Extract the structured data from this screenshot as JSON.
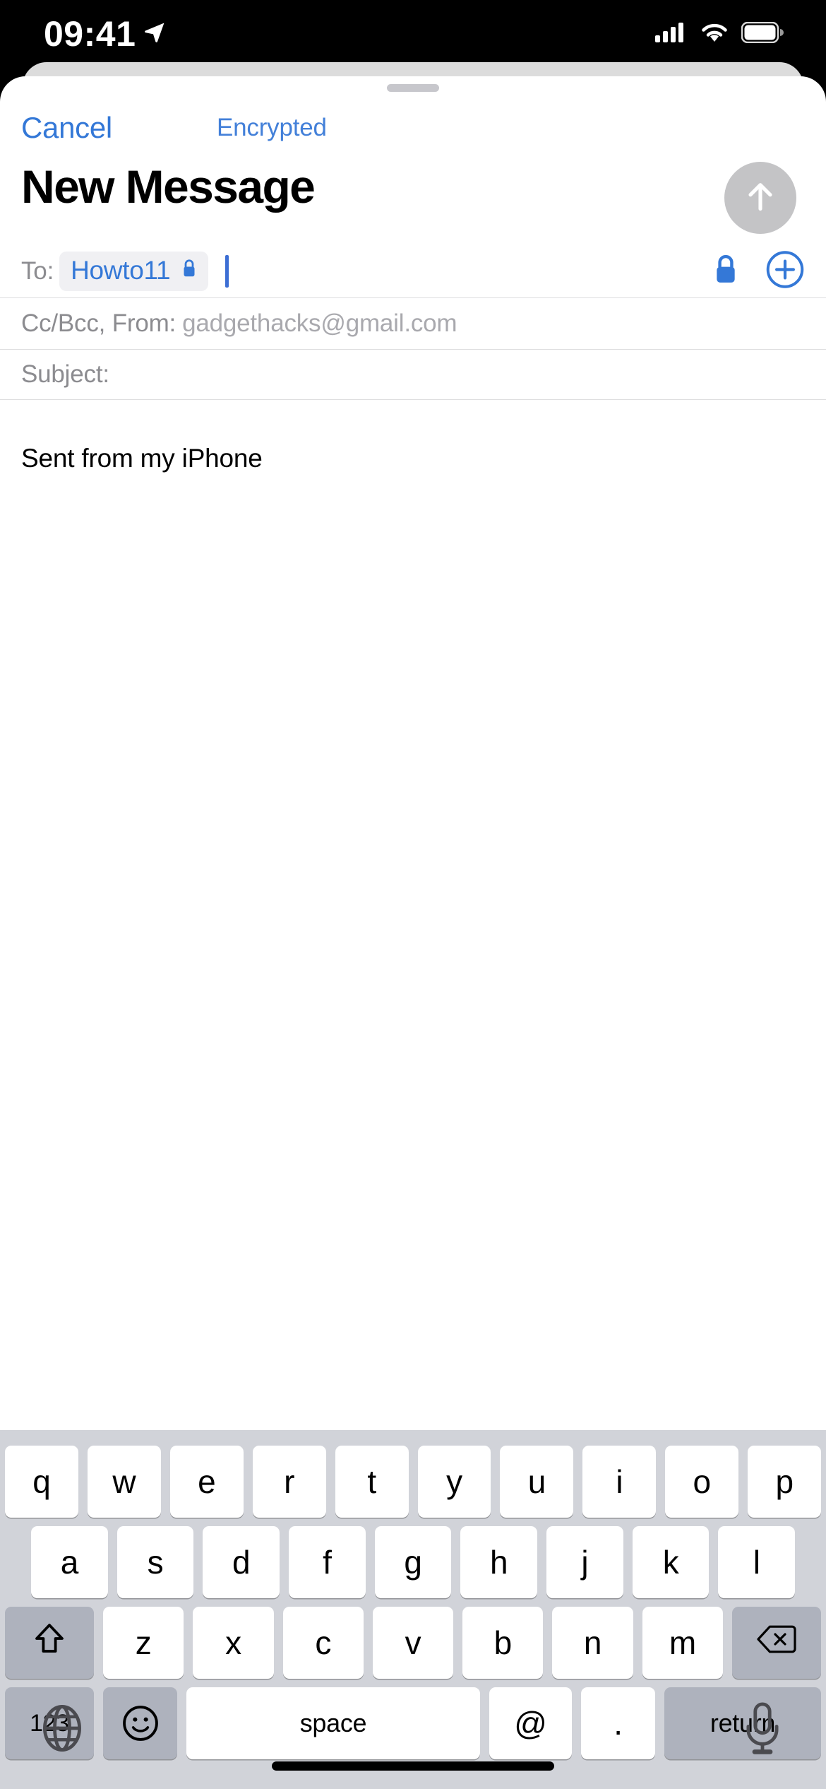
{
  "status_bar": {
    "time": "09:41",
    "location_icon": "location-arrow-icon",
    "signal_icon": "cellular-signal-icon",
    "wifi_icon": "wifi-icon",
    "battery_icon": "battery-icon"
  },
  "nav": {
    "cancel_label": "Cancel",
    "encrypted_label": "Encrypted",
    "grabber": "sheet-grabber"
  },
  "header": {
    "title": "New Message",
    "send_icon": "arrow-up-icon",
    "send_enabled": false,
    "send_bg_color": "#c4c4c6"
  },
  "fields": {
    "to": {
      "label": "To:",
      "recipient": "Howto11",
      "recipient_lock_icon": "lock-filled-icon",
      "encryption_lock_icon": "lock-filled-icon",
      "add_contact_icon": "plus-circle-icon",
      "caret": "text-cursor"
    },
    "ccbcc": {
      "label": "Cc/Bcc, From:",
      "from_address": "gadgethacks@gmail.com"
    },
    "subject": {
      "label": "Subject:",
      "value": ""
    }
  },
  "body": {
    "signature": "Sent from my iPhone"
  },
  "keyboard": {
    "row1": [
      "q",
      "w",
      "e",
      "r",
      "t",
      "y",
      "u",
      "i",
      "o",
      "p"
    ],
    "row2": [
      "a",
      "s",
      "d",
      "f",
      "g",
      "h",
      "j",
      "k",
      "l"
    ],
    "row3_letters": [
      "z",
      "x",
      "c",
      "v",
      "b",
      "n",
      "m"
    ],
    "shift_icon": "shift-arrow-icon",
    "backspace_icon": "delete-backward-icon",
    "numbers_label": "123",
    "emoji_icon": "emoji-smiley-icon",
    "space_label": "space",
    "at_label": "@",
    "period_label": ".",
    "return_label": "return",
    "globe_icon": "globe-icon",
    "mic_icon": "microphone-icon",
    "bg_color": "#d1d3d9",
    "key_color": "#ffffff",
    "modifier_key_color": "#aeb2bd"
  },
  "colors": {
    "ios_blue": "#3478d7",
    "sheet_bg": "#ffffff",
    "placeholder_gray": "#8c8c90"
  }
}
